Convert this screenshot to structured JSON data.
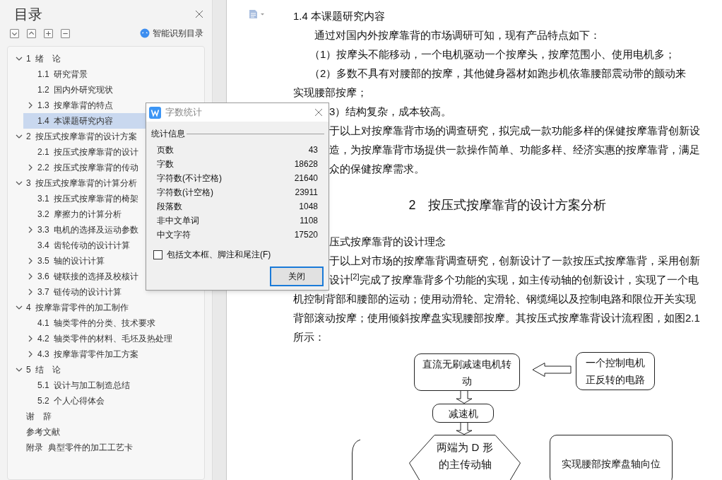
{
  "sidebar": {
    "title": "目录",
    "tools": [
      {
        "kind": "expand-all"
      },
      {
        "kind": "collapse-all"
      },
      {
        "kind": "plus"
      },
      {
        "kind": "minus"
      }
    ],
    "smart_button": "智能识别目录",
    "toc": [
      {
        "label": "1  绪　论",
        "expandable": true,
        "expanded": true,
        "selected": false,
        "children": [
          {
            "label": "1.1  研究背景",
            "expandable": false,
            "selected": false
          },
          {
            "label": "1.2  国内外研究现状",
            "expandable": false,
            "selected": false
          },
          {
            "label": "1.3  按摩靠背的特点",
            "expandable": true,
            "expanded": false,
            "selected": false
          },
          {
            "label": "1.4  本课题研究内容",
            "expandable": false,
            "selected": true
          }
        ]
      },
      {
        "label": "2  按压式按摩靠背的设计方案",
        "expandable": true,
        "expanded": true,
        "selected": false,
        "children": [
          {
            "label": "2.1  按压式按摩靠背的设计",
            "expandable": false,
            "selected": false
          },
          {
            "label": "2.2  按压式按摩靠背的传动",
            "expandable": true,
            "expanded": false,
            "selected": false
          }
        ]
      },
      {
        "label": "3  按压式按摩靠背的计算分析",
        "expandable": true,
        "expanded": true,
        "selected": false,
        "children": [
          {
            "label": "3.1  按压式按摩靠背的椅架",
            "expandable": false,
            "selected": false
          },
          {
            "label": "3.2  摩擦力的计算分析",
            "expandable": false,
            "selected": false
          },
          {
            "label": "3.3  电机的选择及运动参数",
            "expandable": true,
            "expanded": false,
            "selected": false
          },
          {
            "label": "3.4  齿轮传动的设计计算",
            "expandable": false,
            "selected": false
          },
          {
            "label": "3.5  轴的设计计算",
            "expandable": true,
            "expanded": false,
            "selected": false
          },
          {
            "label": "3.6  键联接的选择及校核计",
            "expandable": true,
            "expanded": false,
            "selected": false
          },
          {
            "label": "3.7  链传动的设计计算",
            "expandable": true,
            "expanded": false,
            "selected": false
          }
        ]
      },
      {
        "label": "4  按摩靠背零件的加工制作",
        "expandable": true,
        "expanded": true,
        "selected": false,
        "children": [
          {
            "label": "4.1  轴类零件的分类、技术要求",
            "expandable": false,
            "selected": false
          },
          {
            "label": "4.2  轴类零件的材料、毛坯及热处理",
            "expandable": true,
            "expanded": false,
            "selected": false
          },
          {
            "label": "4.3  按摩靠背零件加工方案",
            "expandable": true,
            "expanded": false,
            "selected": false
          }
        ]
      },
      {
        "label": "5  结　论",
        "expandable": true,
        "expanded": true,
        "selected": false,
        "children": [
          {
            "label": "5.1  设计与加工制造总结",
            "expandable": false,
            "selected": false
          },
          {
            "label": "5.2  个人心得体会",
            "expandable": false,
            "selected": false
          }
        ]
      },
      {
        "label": "谢　辞",
        "expandable": false,
        "selected": false
      },
      {
        "label": "参考文献",
        "expandable": false,
        "selected": false
      },
      {
        "label": "附录  典型零件的加工工艺卡",
        "expandable": false,
        "selected": false
      }
    ]
  },
  "document": {
    "lines": [
      {
        "kind": "heading",
        "text": "1.4  本课题研究内容"
      },
      {
        "kind": "para-start",
        "text": "通过对国内外按摩靠背的市场调研可知，现有产品特点如下："
      },
      {
        "kind": "list-item",
        "text": "（1）按摩头不能移动，一个电机驱动一个按摩头，按摩范围小、使用电机多；"
      },
      {
        "kind": "list-item",
        "text": "（2）多数不具有对腰部的按摩，其他健身器材如跑步机依靠腰部震动带的颤动来"
      },
      {
        "kind": "continuation",
        "text": "实现腰部按摩；"
      },
      {
        "kind": "obscured",
        "text": "3）结构复杂，成本较高。"
      },
      {
        "kind": "obscured",
        "text": "于以上对按摩靠背市场的调查研究，拟完成一款功能多样的保健按摩靠背创新设"
      },
      {
        "kind": "obscured",
        "text": "造，为按摩靠背市场提供一款操作简单、功能多样、经济实惠的按摩靠背，满足"
      },
      {
        "kind": "obscured",
        "text": "众的保健按摩需求。"
      },
      {
        "kind": "chapter",
        "text": "2　按压式按摩靠背的设计方案分析"
      },
      {
        "kind": "obscured",
        "text": "压式按摩靠背的设计理念"
      },
      {
        "kind": "obscured",
        "text": "于以上对市场的按摩靠背调查研究，创新设计了一款按压式按摩靠背，采用创新"
      },
      {
        "kind": "obscured",
        "text": "设计$^{[2]}$完成了按摩靠背多个功能的实现，如主传动轴的创新设计，实现了一个电"
      },
      {
        "kind": "continuation",
        "text": "机控制背部和腰部的运动；使用动滑轮、定滑轮、钢缆绳以及控制电路和限位开关实现"
      },
      {
        "kind": "continuation",
        "text": "背部滚动按摩；使用倾斜按摩盘实现腰部按摩。其按压式按摩靠背设计流程图，如图2.1"
      },
      {
        "kind": "continuation",
        "text": "所示："
      }
    ],
    "flowchart": {
      "nodes": [
        {
          "kind": "rounded",
          "text": "直流无刷减速电机转动"
        },
        {
          "kind": "rounded",
          "text": "一个控制电机正反转的电路"
        },
        {
          "kind": "rounded",
          "text": "减速机"
        },
        {
          "kind": "hexagon",
          "text": "两端为 D 形的主传动轴"
        },
        {
          "kind": "rounded",
          "text": "实现腰部按摩盘轴向位"
        }
      ]
    }
  },
  "dialog": {
    "title": "字数统计",
    "group": "统计信息",
    "stats": [
      {
        "label": "页数",
        "value": "43"
      },
      {
        "label": "字数",
        "value": "18628"
      },
      {
        "label": "字符数(不计空格)",
        "value": "21640"
      },
      {
        "label": "字符数(计空格)",
        "value": "23911"
      },
      {
        "label": "段落数",
        "value": "1048"
      },
      {
        "label": "非中文单词",
        "value": "1108"
      },
      {
        "label": "中文字符",
        "value": "17520"
      }
    ],
    "checkbox": {
      "label": "包括文本框、脚注和尾注(F)",
      "checked": false
    },
    "button": "关闭"
  }
}
